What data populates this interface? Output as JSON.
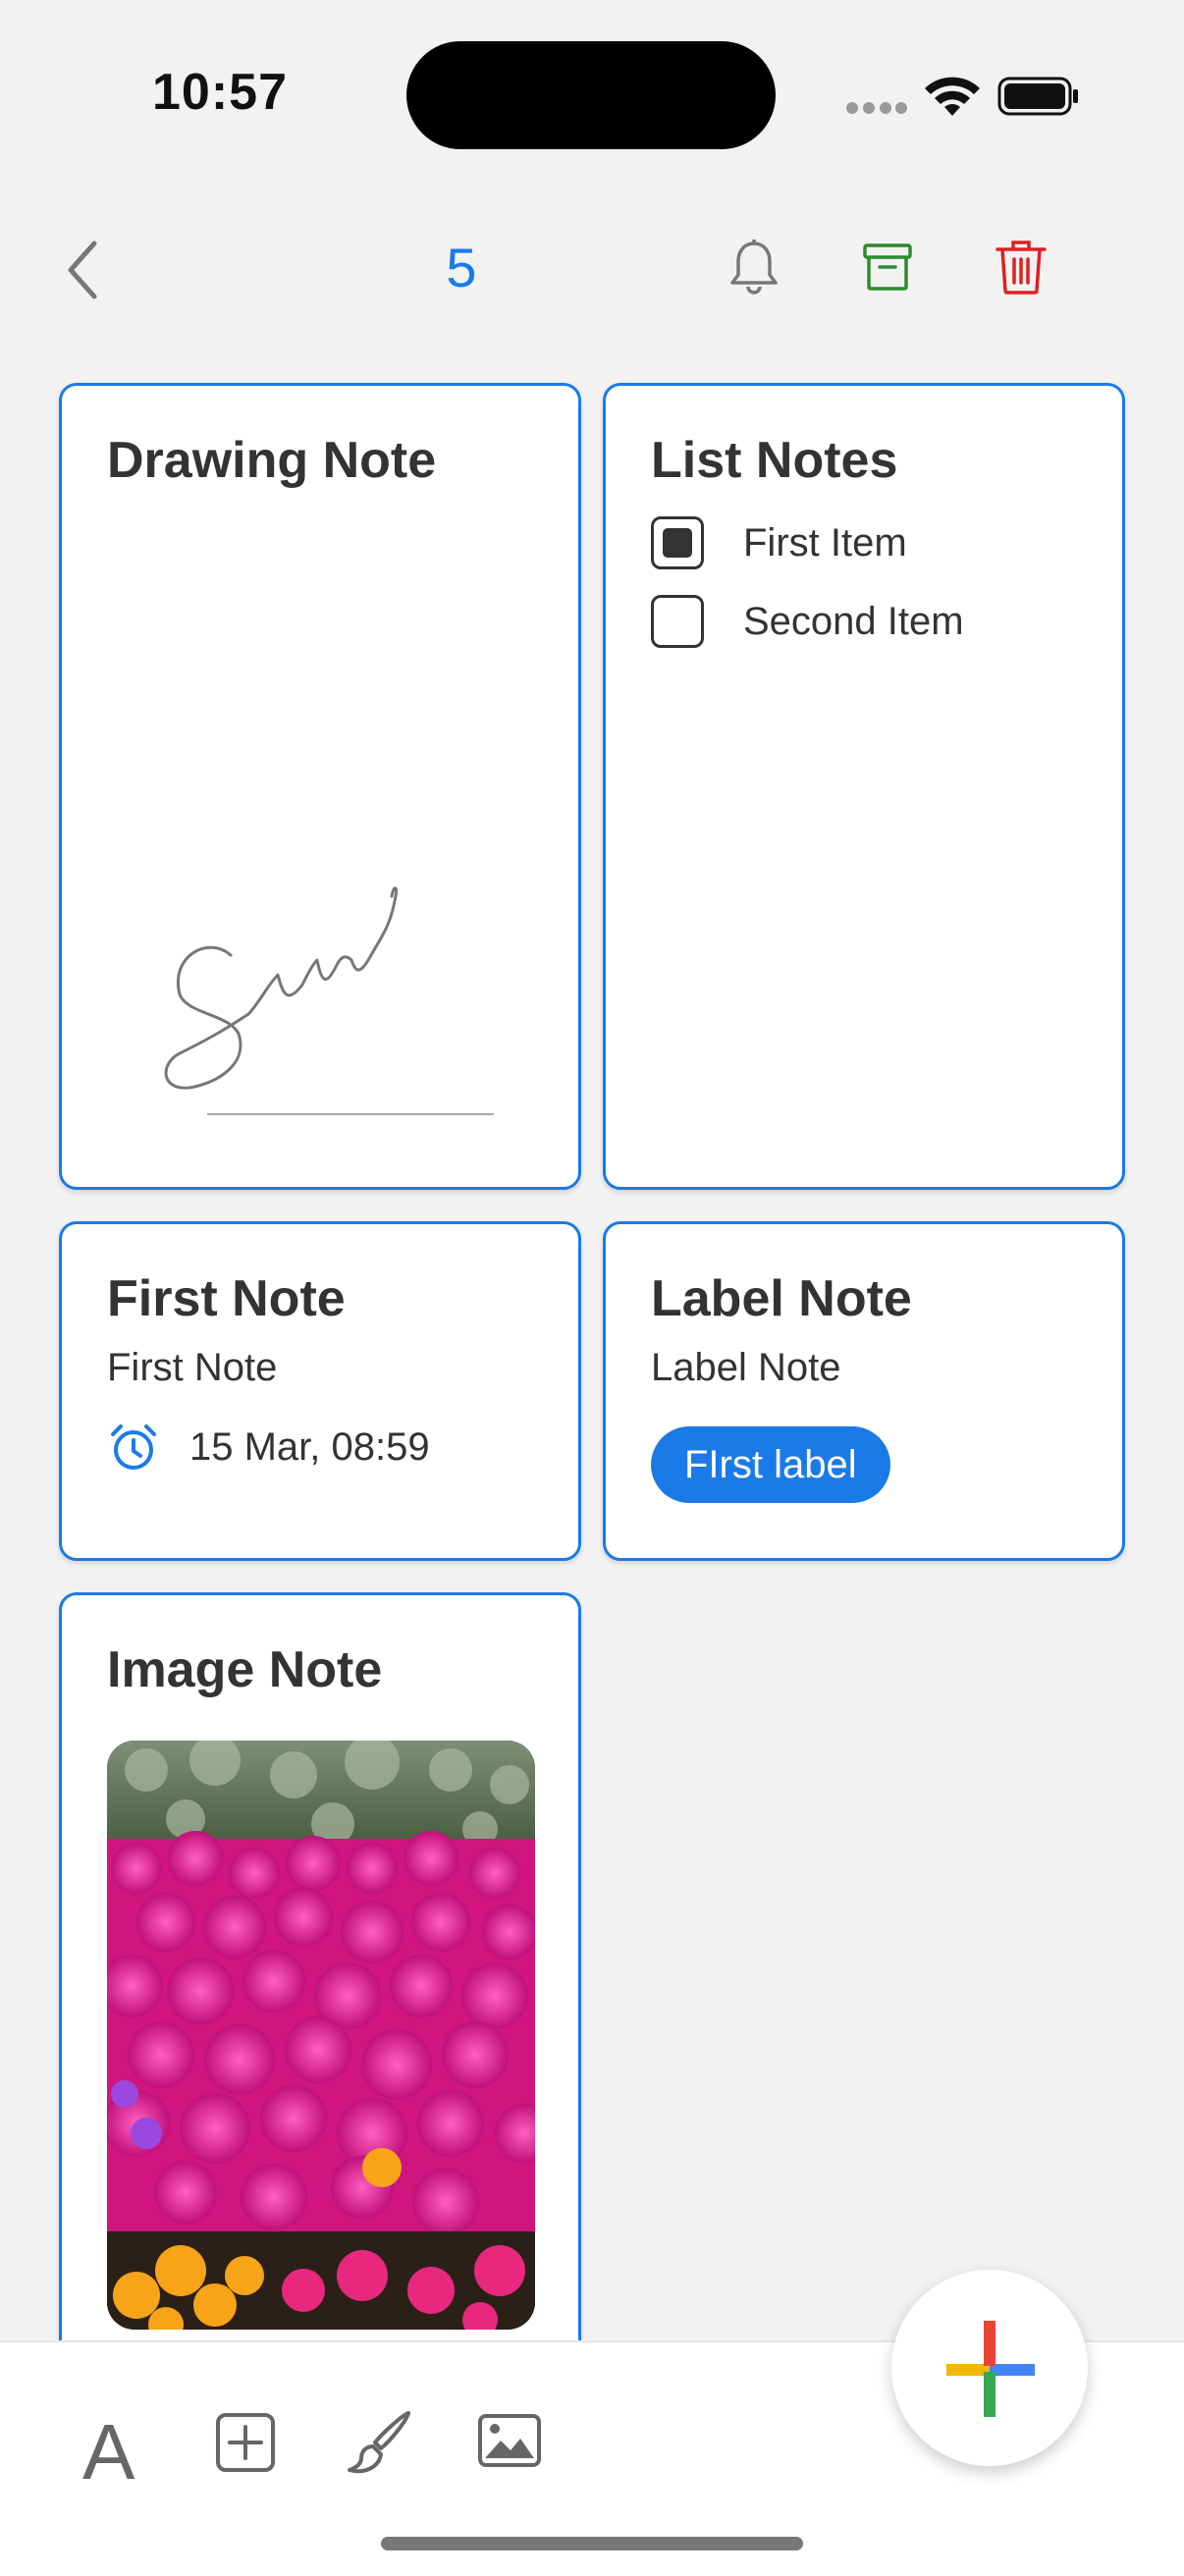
{
  "status_bar": {
    "time": "10:57"
  },
  "top_bar": {
    "selected_count": "5"
  },
  "notes": {
    "drawing": {
      "title": "Drawing Note"
    },
    "list": {
      "title": "List Notes",
      "items": [
        {
          "label": "First Item",
          "checked": true
        },
        {
          "label": "Second Item",
          "checked": false
        }
      ]
    },
    "first": {
      "title": "First Note",
      "body": "First Note",
      "reminder": "15 Mar, 08:59"
    },
    "label": {
      "title": "Label Note",
      "body": "Label Note",
      "chip": "FIrst label"
    },
    "image": {
      "title": "Image Note"
    }
  },
  "toolbar": {
    "text_tool_glyph": "A",
    "icons": [
      "text-format-icon",
      "add-box-icon",
      "brush-icon",
      "image-icon"
    ]
  },
  "colors": {
    "accent": "#1a7ae8",
    "archive": "#2e8b2e",
    "delete": "#e02020",
    "background": "#f2f2f3"
  }
}
